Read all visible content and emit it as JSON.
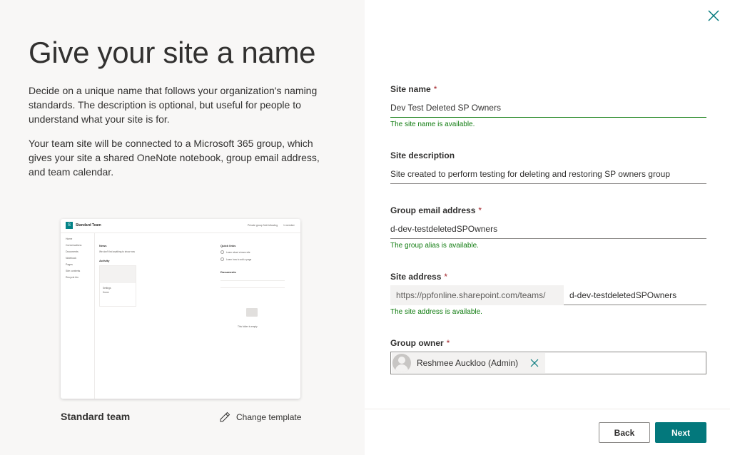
{
  "left": {
    "title": "Give your site a name",
    "description_1": "Decide on a unique name that follows your organization's naming standards. The description is optional, but useful for people to understand what your site is for.",
    "description_2": "Your team site will be connected to a Microsoft 365 group, which gives your site a shared OneNote notebook, group email address, and team calendar.",
    "template_name": "Standard team",
    "change_template_label": "Change template",
    "preview": {
      "site_title": "Standard Team",
      "header_right": [
        "Private group",
        "Not following",
        "1 member"
      ],
      "nav": [
        "Home",
        "Conversations",
        "Documents",
        "Notebook",
        "Pages",
        "Site contents",
        "Recycle bin"
      ],
      "news_label": "News",
      "news_text": "We don't find anything to show now",
      "activity_label": "Activity",
      "quick_links_label": "Quick links",
      "quick_links": [
        "Learn about a team site",
        "Learn how to add a page"
      ],
      "documents_label": "Documents",
      "documents_empty": "This folder is empty",
      "card_title": "Settings",
      "card_sub": "Home"
    }
  },
  "form": {
    "site_name": {
      "label": "Site name",
      "required_marker": "*",
      "value": "Dev Test Deleted SP Owners",
      "hint": "The site name is available."
    },
    "site_description": {
      "label": "Site description",
      "value": "Site created to perform testing for deleting and restoring SP owners group"
    },
    "group_email": {
      "label": "Group email address",
      "required_marker": "*",
      "value": "d-dev-testdeletedSPOwners",
      "hint": "The group alias is available."
    },
    "site_address": {
      "label": "Site address",
      "required_marker": "*",
      "prefix": "https://ppfonline.sharepoint.com/teams/",
      "value": "d-dev-testdeletedSPOwners",
      "hint": "The site address is available."
    },
    "group_owner": {
      "label": "Group owner",
      "required_marker": "*",
      "owner_name": "Reshmee Auckloo (Admin)"
    }
  },
  "buttons": {
    "back": "Back",
    "next": "Next"
  },
  "colors": {
    "accent": "#03787c",
    "success": "#107c10",
    "required": "#a4262c",
    "left_bg": "#f8f7f6"
  }
}
